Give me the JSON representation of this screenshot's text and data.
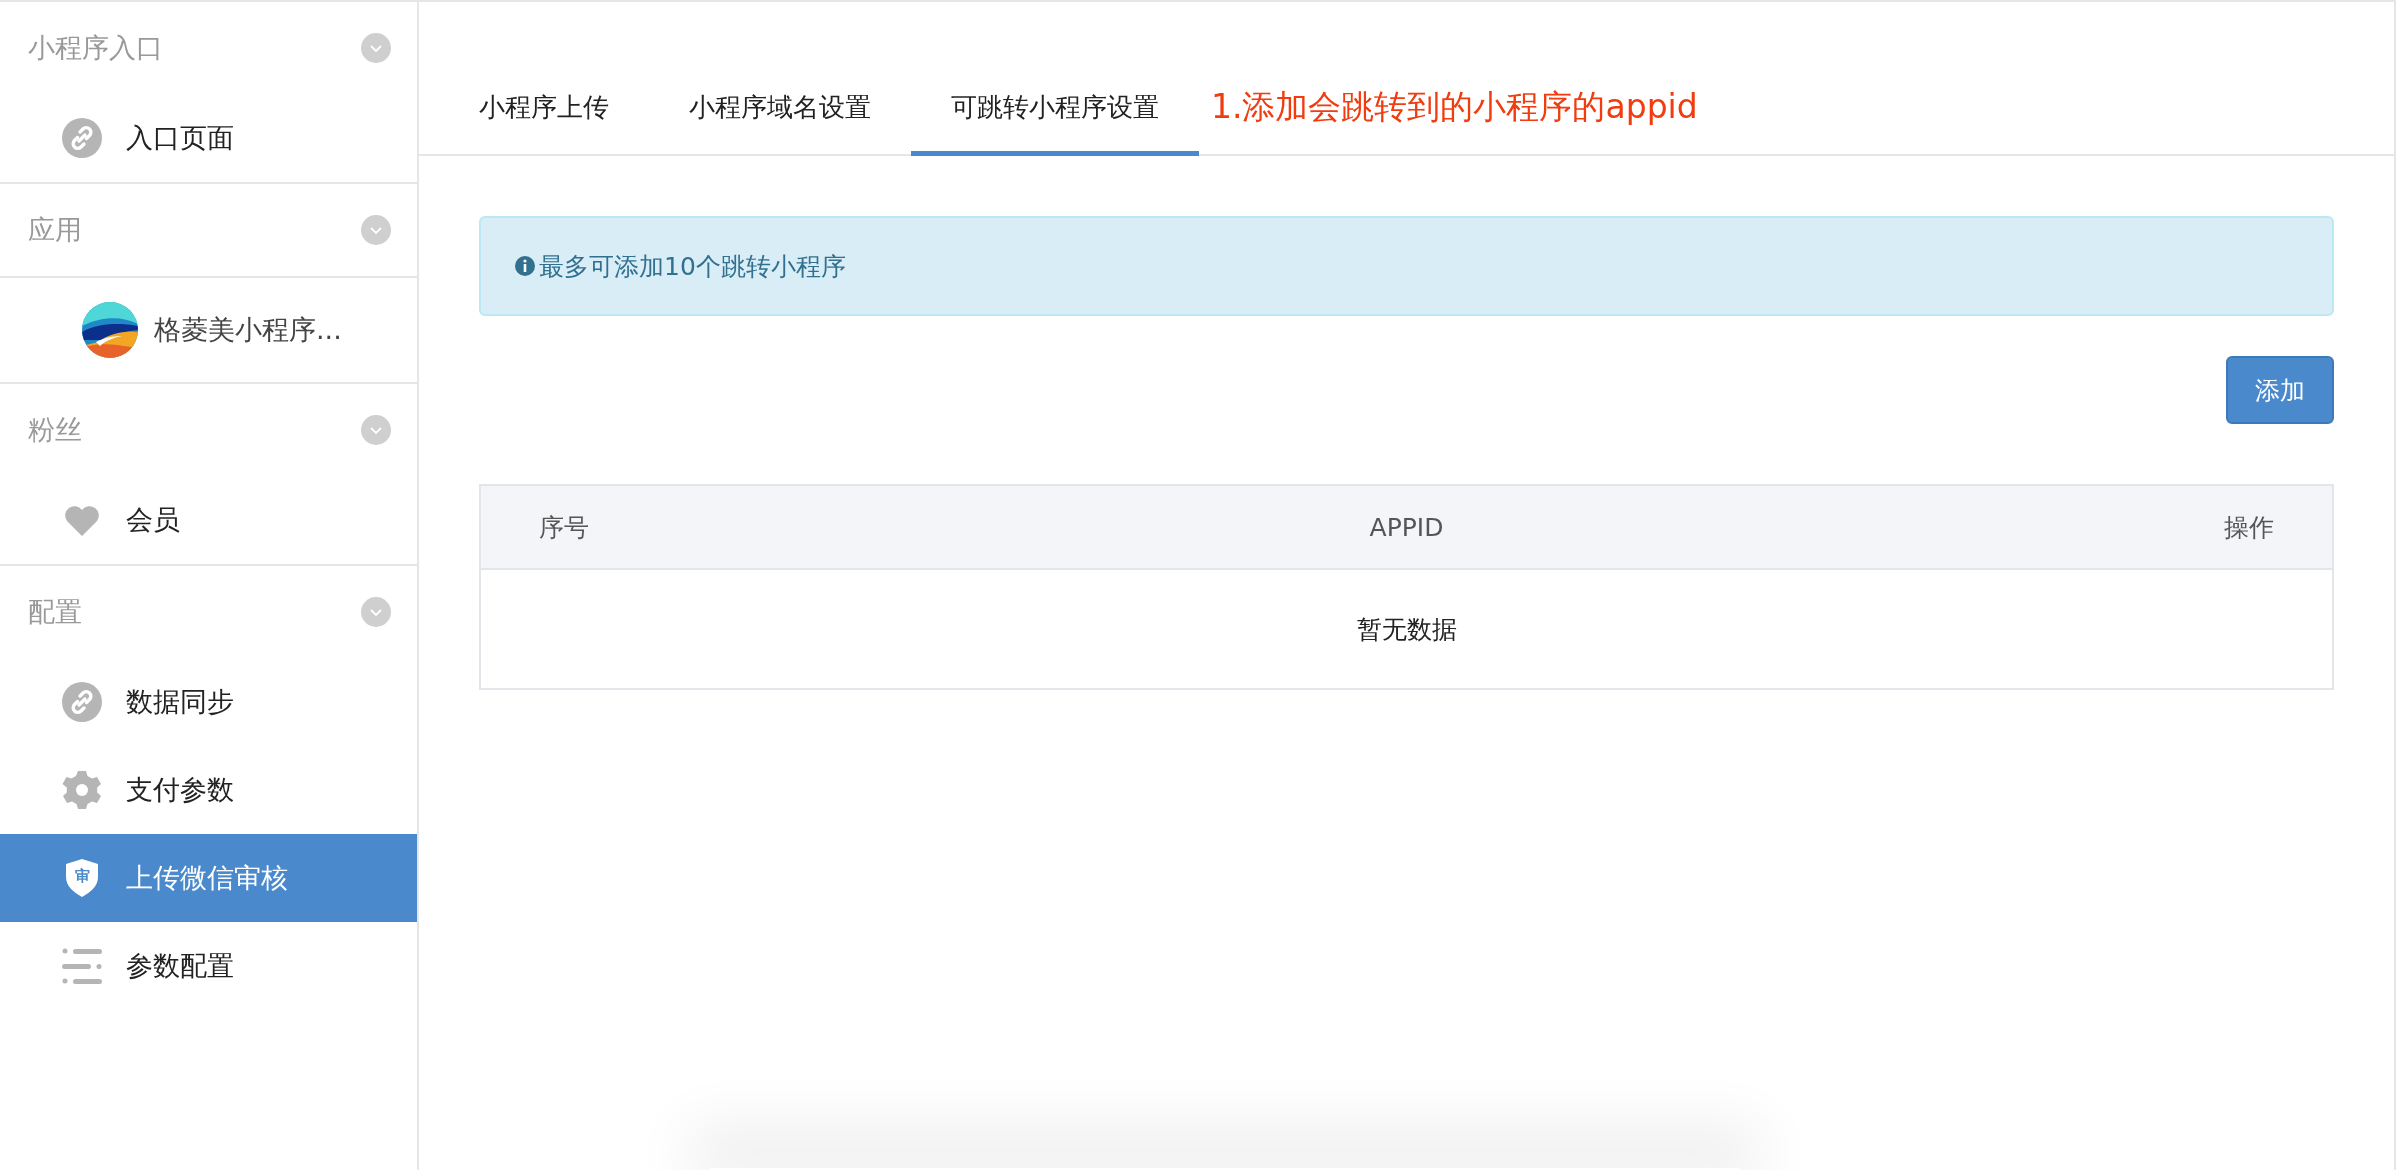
{
  "sidebar": {
    "groups": [
      {
        "title": "小程序入口",
        "expanded": true,
        "items": [
          {
            "kind": "link",
            "label": "入口页面",
            "selected": false
          }
        ]
      },
      {
        "title": "应用",
        "expanded": true,
        "items": [
          {
            "kind": "app",
            "label": "格菱美小程序...",
            "selected": false
          }
        ]
      },
      {
        "title": "粉丝",
        "expanded": true,
        "items": [
          {
            "kind": "heart",
            "label": "会员",
            "selected": false
          }
        ]
      },
      {
        "title": "配置",
        "expanded": true,
        "items": [
          {
            "kind": "link",
            "label": "数据同步",
            "selected": false
          },
          {
            "kind": "gear",
            "label": "支付参数",
            "selected": false
          },
          {
            "kind": "shield",
            "label": "上传微信审核",
            "badge": "审",
            "selected": true
          },
          {
            "kind": "list",
            "label": "参数配置",
            "selected": false
          }
        ]
      }
    ]
  },
  "tabs": [
    {
      "label": "小程序上传",
      "selected": false
    },
    {
      "label": "小程序域名设置",
      "selected": false
    },
    {
      "label": "可跳转小程序设置",
      "selected": true
    }
  ],
  "annotation": "1.添加会跳转到的小程序的appid",
  "alert": {
    "text": "最多可添加10个跳转小程序"
  },
  "add_button": "添加",
  "table": {
    "columns": [
      "序号",
      "APPID",
      "操作"
    ],
    "empty_text": "暂无数据"
  }
}
